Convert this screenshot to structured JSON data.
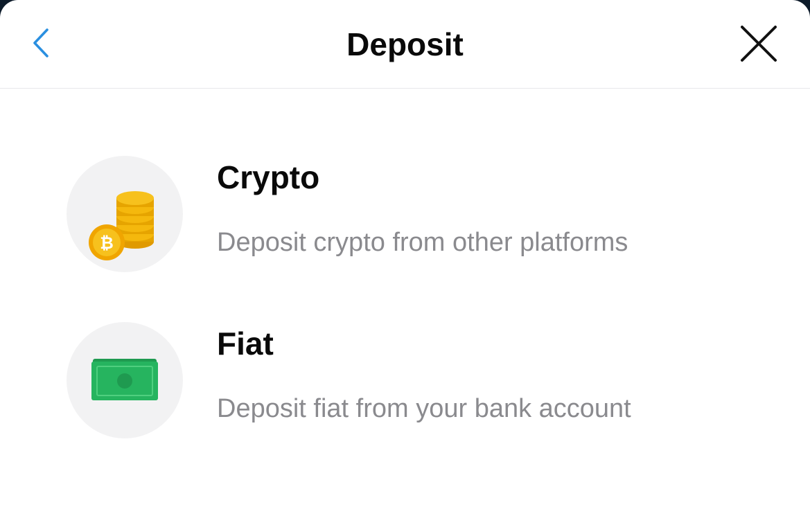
{
  "header": {
    "title": "Deposit",
    "back_icon": "chevron-left-icon",
    "close_icon": "close-icon",
    "accent_color": "#2a8fe0"
  },
  "options": [
    {
      "title": "Crypto",
      "description": "Deposit crypto from other platforms",
      "icon": "bitcoin-coins-icon"
    },
    {
      "title": "Fiat",
      "description": "Deposit fiat from your bank account",
      "icon": "banknote-icon"
    }
  ],
  "colors": {
    "coin_gold": "#f5b80d",
    "note_green": "#26b45f"
  }
}
